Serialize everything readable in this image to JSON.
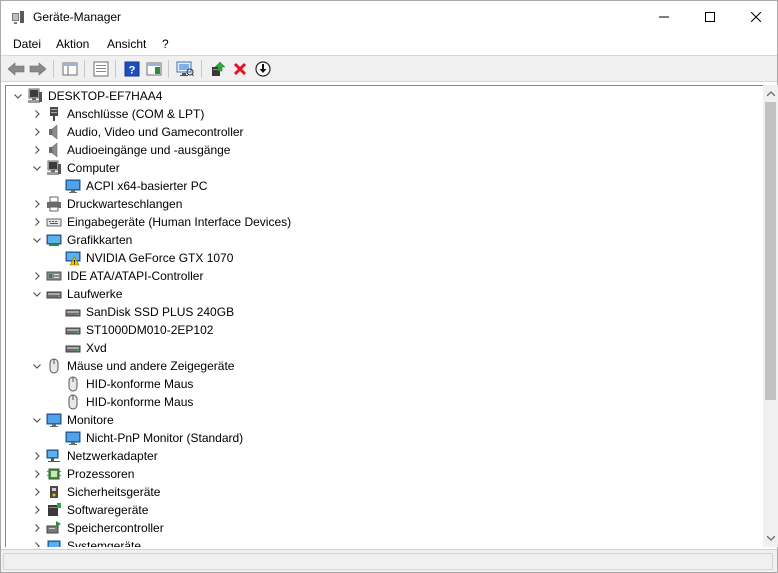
{
  "window": {
    "title": "Geräte-Manager",
    "controls": [
      "minimize",
      "maximize",
      "close"
    ]
  },
  "menu": {
    "file": "Datei",
    "action": "Aktion",
    "view": "Ansicht",
    "help": "?"
  },
  "toolbar": {
    "icons": [
      "back-icon",
      "forward-icon",
      "show-hide-console-tree-icon",
      "properties-icon",
      "help-icon",
      "action-pane-icon",
      "scan-hardware-icon",
      "update-driver-icon",
      "uninstall-device-icon",
      "enable-device-icon"
    ]
  },
  "tree": {
    "root": "DESKTOP-EF7HAA4",
    "items": [
      {
        "label": "Anschlüsse (COM & LPT)",
        "level": 1,
        "expanded": false
      },
      {
        "label": "Audio, Video und Gamecontroller",
        "level": 1,
        "expanded": false
      },
      {
        "label": "Audioeingänge und -ausgänge",
        "level": 1,
        "expanded": false
      },
      {
        "label": "Computer",
        "level": 1,
        "expanded": true
      },
      {
        "label": "ACPI x64-basierter PC",
        "level": 2
      },
      {
        "label": "Druckwarteschlangen",
        "level": 1,
        "expanded": false
      },
      {
        "label": "Eingabegeräte (Human Interface Devices)",
        "level": 1,
        "expanded": false
      },
      {
        "label": "Grafikkarten",
        "level": 1,
        "expanded": true
      },
      {
        "label": "NVIDIA GeForce GTX 1070",
        "level": 2,
        "warning": true
      },
      {
        "label": "IDE ATA/ATAPI-Controller",
        "level": 1,
        "expanded": false
      },
      {
        "label": "Laufwerke",
        "level": 1,
        "expanded": true
      },
      {
        "label": "SanDisk SSD PLUS 240GB",
        "level": 2
      },
      {
        "label": "ST1000DM010-2EP102",
        "level": 2
      },
      {
        "label": "Xvd",
        "level": 2
      },
      {
        "label": "Mäuse und andere Zeigegeräte",
        "level": 1,
        "expanded": true
      },
      {
        "label": "HID-konforme Maus",
        "level": 2
      },
      {
        "label": "HID-konforme Maus",
        "level": 2
      },
      {
        "label": "Monitore",
        "level": 1,
        "expanded": true
      },
      {
        "label": "Nicht-PnP Monitor (Standard)",
        "level": 2
      },
      {
        "label": "Netzwerkadapter",
        "level": 1,
        "expanded": false
      },
      {
        "label": "Prozessoren",
        "level": 1,
        "expanded": false
      },
      {
        "label": "Sicherheitsgeräte",
        "level": 1,
        "expanded": false
      },
      {
        "label": "Softwaregeräte",
        "level": 1,
        "expanded": false
      },
      {
        "label": "Speichercontroller",
        "level": 1,
        "expanded": false
      },
      {
        "label": "Systemgeräte",
        "level": 1,
        "expanded": false
      }
    ]
  },
  "colors": {
    "accent_blue": "#1e73be",
    "uninstall_red": "#e81123",
    "toolbar_bg": "#f0f0f0"
  }
}
